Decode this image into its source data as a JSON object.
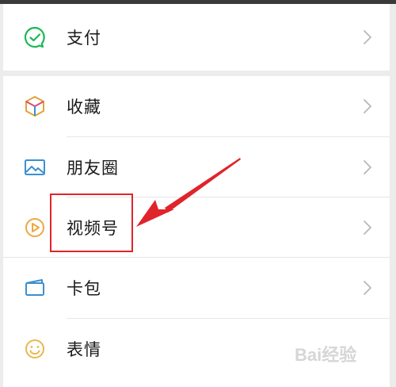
{
  "menu": {
    "items": [
      {
        "key": "pay",
        "label": "支付",
        "icon": "wechat-pay-icon"
      },
      {
        "key": "favorites",
        "label": "收藏",
        "icon": "cube-icon"
      },
      {
        "key": "moments",
        "label": "朋友圈",
        "icon": "image-icon"
      },
      {
        "key": "channels",
        "label": "视频号",
        "icon": "play-icon"
      },
      {
        "key": "cards",
        "label": "卡包",
        "icon": "card-wallet-icon"
      },
      {
        "key": "stickers",
        "label": "表情",
        "icon": "smiley-icon"
      }
    ]
  },
  "annotation": {
    "highlight_color": "#e0242b",
    "arrow_color": "#e0242b"
  },
  "colors": {
    "pay_green": "#19b955",
    "channels_orange": "#f0a640",
    "cards_blue": "#3b8fd0"
  },
  "watermark": {
    "text": "Bai经验"
  }
}
